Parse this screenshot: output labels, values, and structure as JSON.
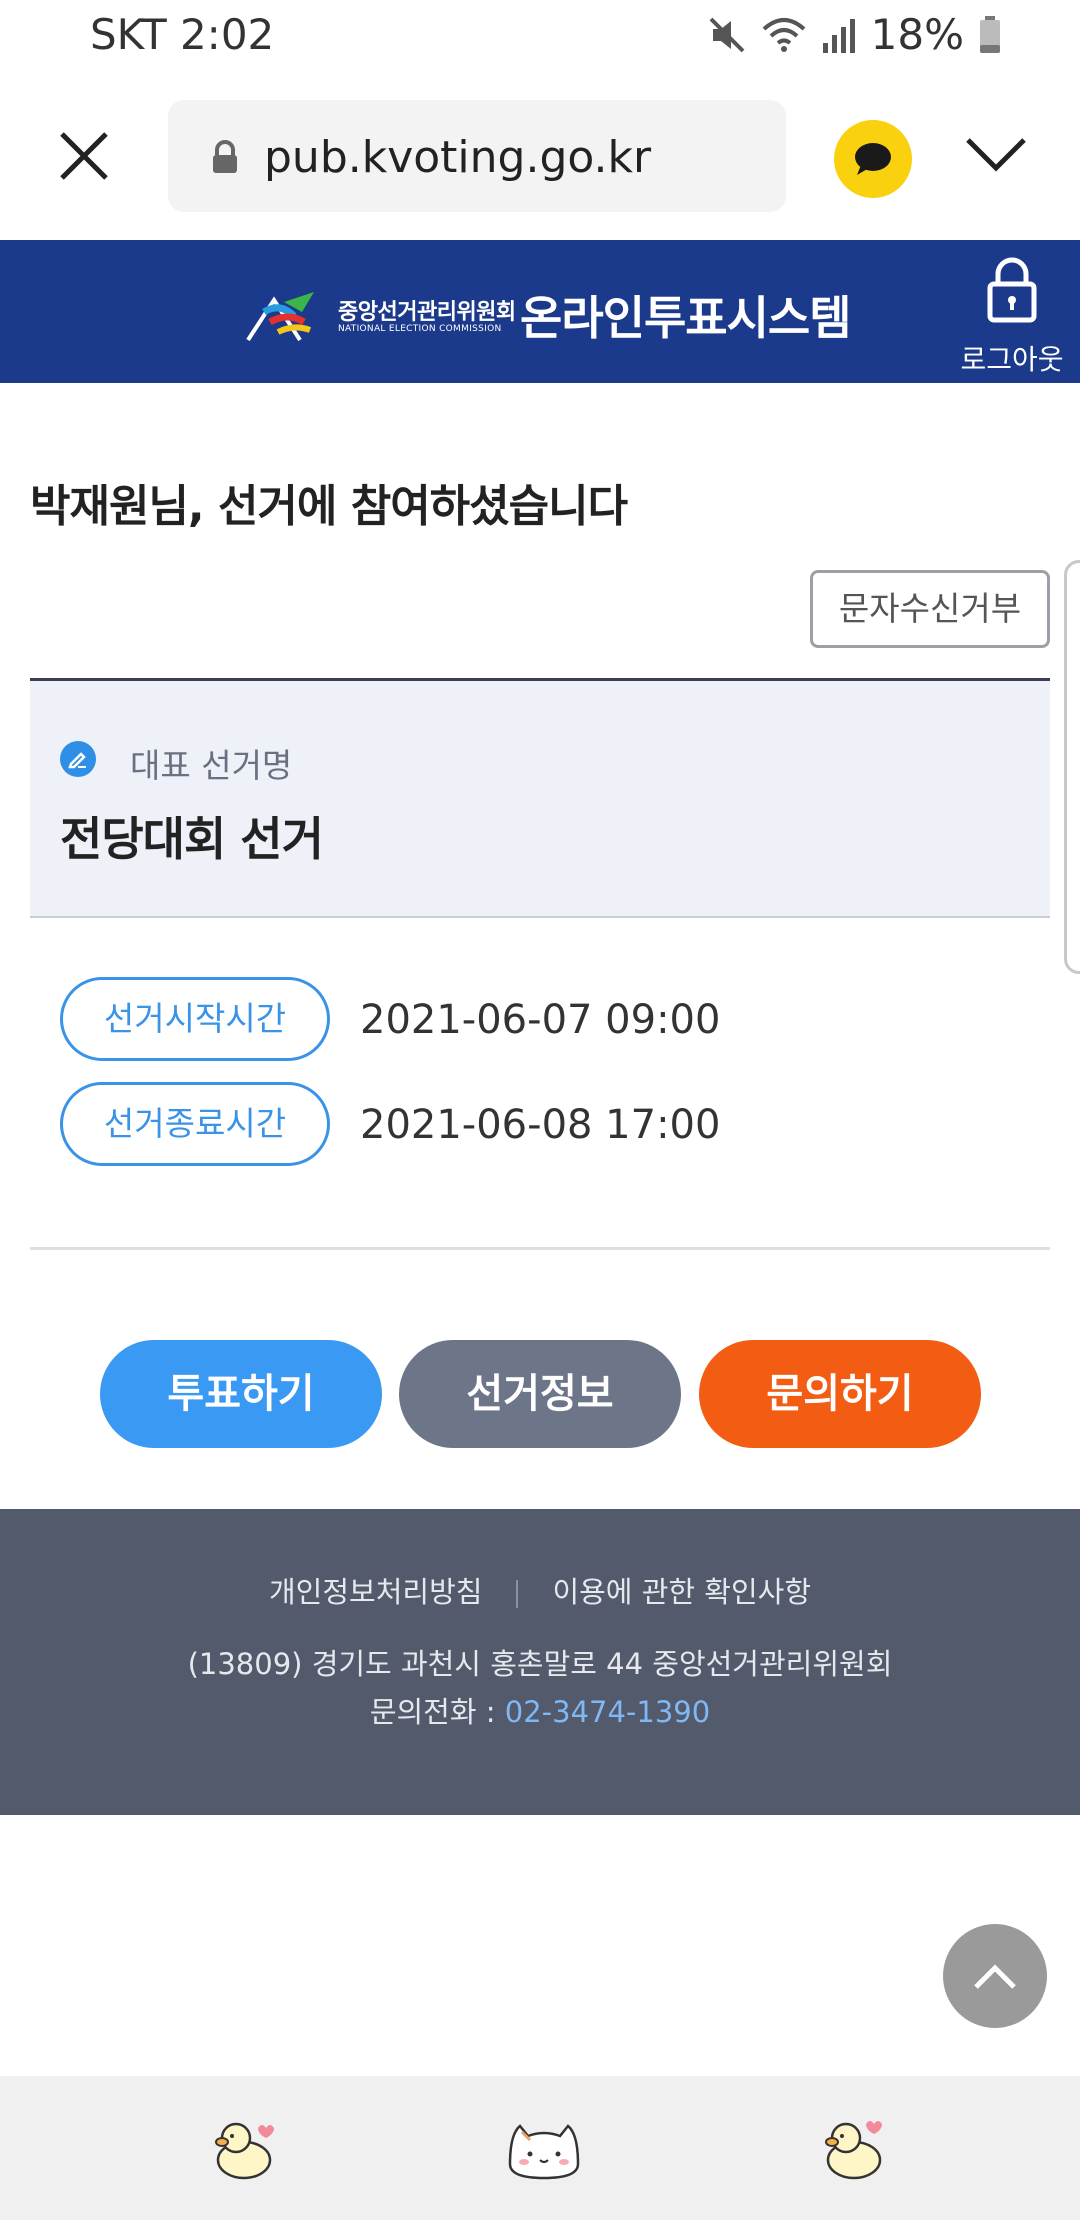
{
  "status_bar": {
    "carrier_time": "SKT 2:02",
    "battery": "18%"
  },
  "browser": {
    "url": "pub.kvoting.go.kr"
  },
  "header": {
    "org_kr": "중앙선거관리위원회",
    "org_en": "NATIONAL ELECTION COMMISSION",
    "system_title": "온라인투표시스템",
    "logout_label": "로그아웃"
  },
  "main": {
    "welcome": "박재원님, 선거에 참여하셨습니다",
    "sms_reject_label": "문자수신거부",
    "election_label": "대표 선거명",
    "election_name": "전당대회 선거",
    "start_label": "선거시작시간",
    "start_time": "2021-06-07 09:00",
    "end_label": "선거종료시간",
    "end_time": "2021-06-08 17:00",
    "buttons": {
      "vote": "투표하기",
      "info": "선거정보",
      "ask": "문의하기"
    }
  },
  "footer": {
    "privacy": "개인정보처리방침",
    "terms": "이용에 관한 확인사항",
    "address": "(13809) 경기도 과천시 홍촌말로 44 중앙선거관리위원회",
    "tel_label": "문의전화 :",
    "tel_number": "02-3474-1390"
  },
  "colors": {
    "header_bg": "#1c3a8c",
    "vote_btn": "#3a99f2",
    "info_btn": "#6d7589",
    "ask_btn": "#f25c13",
    "footer_bg": "#525a6b",
    "accent_blue": "#3a93e6"
  }
}
